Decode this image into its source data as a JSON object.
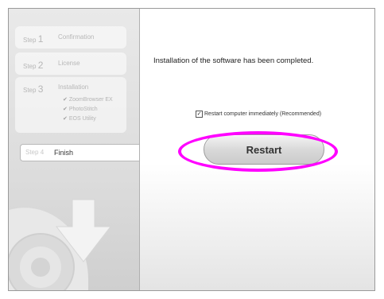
{
  "sidebar": {
    "steps": [
      {
        "prefix": "Step",
        "num": "1",
        "label": "Confirmation"
      },
      {
        "prefix": "Step",
        "num": "2",
        "label": "License"
      },
      {
        "prefix": "Step",
        "num": "3",
        "label": "Installation",
        "items": [
          "ZoomBrowser EX",
          "PhotoStitch",
          "EOS Utility"
        ]
      },
      {
        "prefix": "Step",
        "num": "4",
        "label": "Finish"
      }
    ]
  },
  "main": {
    "message": "Installation of the software has been completed.",
    "restart_option": {
      "label": "Restart computer immediately (Recommended)",
      "checked": true
    },
    "restart_button": "Restart"
  },
  "colors": {
    "highlight": "#ff00ff"
  }
}
